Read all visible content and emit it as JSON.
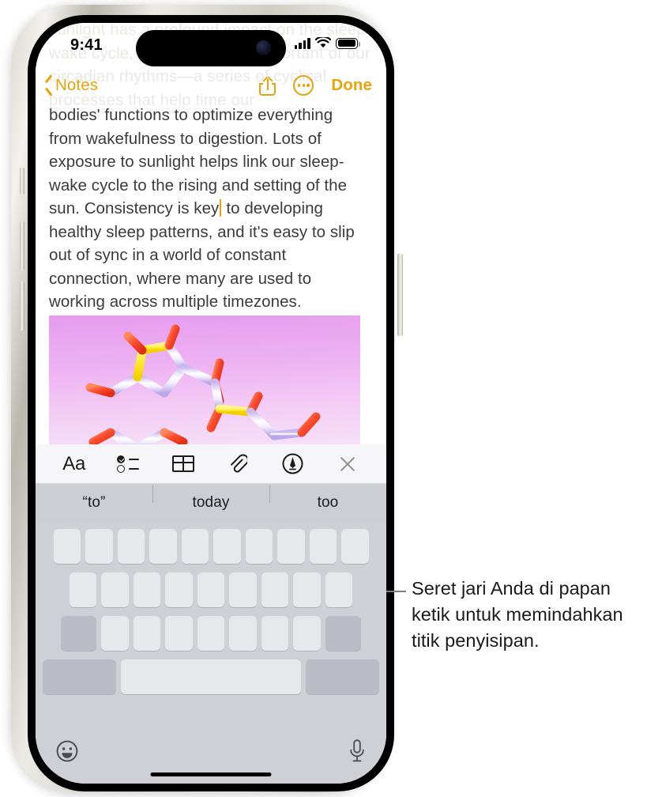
{
  "status_bar": {
    "time": "9:41",
    "signal_icon": "cellular-signal-icon",
    "wifi_icon": "wifi-icon",
    "battery_icon": "battery-icon"
  },
  "nav_bar": {
    "back_label": "Notes",
    "back_icon": "chevron-left-icon",
    "share_icon": "share-icon",
    "more_icon": "more-ellipsis-icon",
    "done_label": "Done"
  },
  "note": {
    "ghost_text": "sunlight has a profound impact on the sleep-wake cycle, one of the most important of our circadian rhythms—a series of cyclical processes that help time our",
    "body_before_caret": "bodies' functions to optimize everything from wakefulness to digestion. Lots of exposure to sunlight helps link our sleep-wake cycle to the rising and setting of the sun. Consistency is key",
    "body_after_caret": " to developing healthy sleep patterns, and it's easy to slip out of sync in a world of constant connection, where many are used to working across multiple timezones.",
    "image_alt": "molecule-illustration"
  },
  "format_toolbar": {
    "items": [
      {
        "name": "text-format-button",
        "glyph": "Aa",
        "icon": "text-format-icon"
      },
      {
        "name": "checklist-button",
        "icon": "checklist-icon"
      },
      {
        "name": "table-button",
        "icon": "table-icon"
      },
      {
        "name": "attachment-button",
        "icon": "paperclip-icon"
      },
      {
        "name": "markup-button",
        "icon": "markup-pen-icon"
      },
      {
        "name": "close-keyboard-button",
        "icon": "close-x-icon"
      }
    ]
  },
  "predictive_bar": {
    "suggestions": [
      "“to”",
      "today",
      "too"
    ]
  },
  "keyboard": {
    "mode": "trackpad-blank-keys",
    "row1_keys": 10,
    "row2_keys": 9,
    "row3_letter_keys": 7,
    "shift_key": "shift-key",
    "delete_key": "delete-key",
    "numbers_key": "numbers-key",
    "space_key": "space-key",
    "return_key": "return-key",
    "emoji_icon": "emoji-smiley-icon",
    "dictation_icon": "microphone-icon",
    "home_indicator": "home-indicator"
  },
  "callout": {
    "text": "Seret jari Anda di papan ketik untuk memindahkan titik penyisipan."
  },
  "colors": {
    "accent": "#E5A50A",
    "keyboard_bg": "#CED0D6",
    "key_light": "#E7E8EC",
    "key_dark": "#B9BCC4",
    "predict_bg": "#CDCED5",
    "toolbar_bg": "#F6F6F8",
    "body_text": "#3B3B3D"
  }
}
